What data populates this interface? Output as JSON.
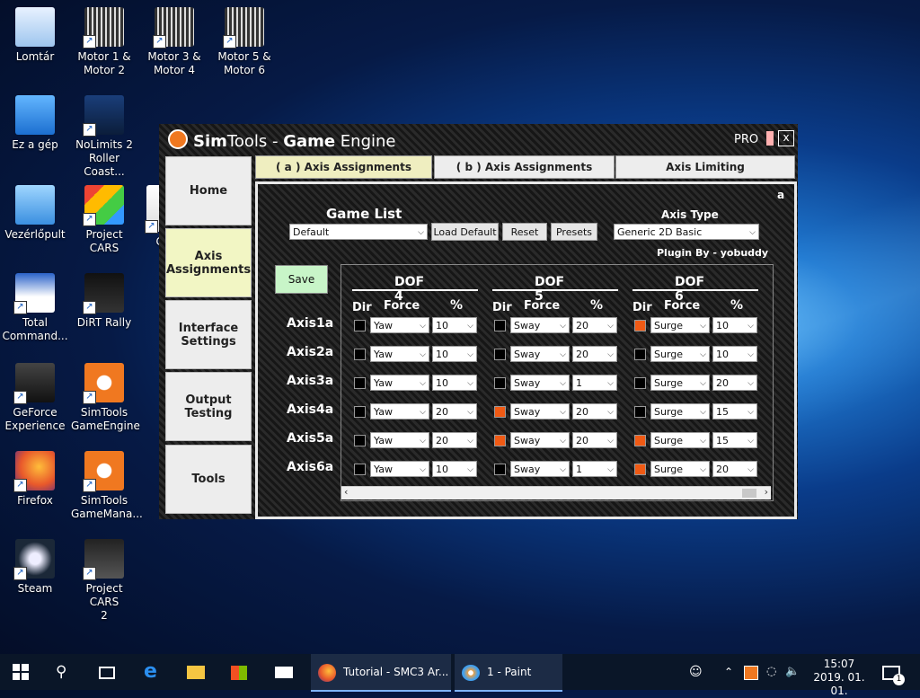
{
  "desktop_icons": [
    {
      "label": "Lomtár",
      "icon": "recycle-bin-icon"
    },
    {
      "label": "Motor 1 &\nMotor 2",
      "icon": "motor-chip-icon"
    },
    {
      "label": "Motor 3 &\nMotor 4",
      "icon": "motor-chip-icon"
    },
    {
      "label": "Motor 5 &\nMotor 6",
      "icon": "motor-chip-icon"
    },
    {
      "label": "Ez a gép",
      "icon": "computer-icon"
    },
    {
      "label": "NoLimits 2\nRoller Coast...",
      "icon": "nolimits-icon"
    },
    {
      "label": "Vezérlőpult",
      "icon": "control-panel-icon"
    },
    {
      "label": "Project CARS",
      "icon": "project-cars-icon"
    },
    {
      "label": "Co...",
      "icon": "oculus-icon"
    },
    {
      "label": "Total\nCommand...",
      "icon": "total-commander-icon"
    },
    {
      "label": "DiRT Rally",
      "icon": "dirt-rally-icon"
    },
    {
      "label": "GeForce\nExperience",
      "icon": "geforce-icon"
    },
    {
      "label": "SimTools\nGameEngine",
      "icon": "simtools-icon"
    },
    {
      "label": "Firefox",
      "icon": "firefox-icon"
    },
    {
      "label": "SimTools\nGameMana...",
      "icon": "simtools-manager-icon"
    },
    {
      "label": "Steam",
      "icon": "steam-icon"
    },
    {
      "label": "Project CARS\n2",
      "icon": "project-cars-2-icon"
    }
  ],
  "window": {
    "title_a": "Sim",
    "title_b": "Tools",
    "title_c": " - ",
    "title_d": "Game",
    "title_e": " Engine",
    "pro": "PRO",
    "close": "x"
  },
  "sidebar": [
    "Home",
    "Axis\nAssignments",
    "Interface\nSettings",
    "Output\nTesting",
    "Tools"
  ],
  "tabs": [
    "( a ) Axis Assignments",
    "( b ) Axis Assignments",
    "Axis Limiting"
  ],
  "panel": {
    "corner_letter": "a",
    "game_list_label": "Game List",
    "game_list_value": "Default",
    "load_default": "Load Default",
    "reset": "Reset",
    "presets": "Presets",
    "axis_type_label": "Axis Type",
    "axis_type_value": "Generic 2D Basic",
    "plugin_by": "Plugin By - yobuddy",
    "save": "Save"
  },
  "dof_headers": [
    "DOF 4",
    "DOF 5",
    "DOF 6"
  ],
  "col_labels": {
    "dir": "Dir",
    "force": "Force",
    "pct": "%"
  },
  "axes": [
    {
      "name": "Axis1a",
      "dof4": {
        "dir": false,
        "force": "Yaw",
        "pct": "10"
      },
      "dof5": {
        "dir": false,
        "force": "Sway",
        "pct": "20"
      },
      "dof6": {
        "dir": true,
        "force": "Surge",
        "pct": "10"
      }
    },
    {
      "name": "Axis2a",
      "dof4": {
        "dir": false,
        "force": "Yaw",
        "pct": "10"
      },
      "dof5": {
        "dir": false,
        "force": "Sway",
        "pct": "20"
      },
      "dof6": {
        "dir": false,
        "force": "Surge",
        "pct": "10"
      }
    },
    {
      "name": "Axis3a",
      "dof4": {
        "dir": false,
        "force": "Yaw",
        "pct": "10"
      },
      "dof5": {
        "dir": false,
        "force": "Sway",
        "pct": "1"
      },
      "dof6": {
        "dir": false,
        "force": "Surge",
        "pct": "20"
      }
    },
    {
      "name": "Axis4a",
      "dof4": {
        "dir": false,
        "force": "Yaw",
        "pct": "20"
      },
      "dof5": {
        "dir": true,
        "force": "Sway",
        "pct": "20"
      },
      "dof6": {
        "dir": false,
        "force": "Surge",
        "pct": "15"
      }
    },
    {
      "name": "Axis5a",
      "dof4": {
        "dir": false,
        "force": "Yaw",
        "pct": "20"
      },
      "dof5": {
        "dir": true,
        "force": "Sway",
        "pct": "20"
      },
      "dof6": {
        "dir": true,
        "force": "Surge",
        "pct": "15"
      }
    },
    {
      "name": "Axis6a",
      "dof4": {
        "dir": false,
        "force": "Yaw",
        "pct": "10"
      },
      "dof5": {
        "dir": false,
        "force": "Sway",
        "pct": "1"
      },
      "dof6": {
        "dir": true,
        "force": "Surge",
        "pct": "20"
      }
    }
  ],
  "taskbar": {
    "firefox_task": "Tutorial - SMC3 Ar...",
    "paint_task": "1 - Paint",
    "time": "15:07",
    "date": "2019. 01. 01.",
    "notif_count": "1"
  },
  "colors": {
    "dir_on": "#f05a14",
    "dir_off": "#000000",
    "accent_tab": "#efeec0"
  }
}
